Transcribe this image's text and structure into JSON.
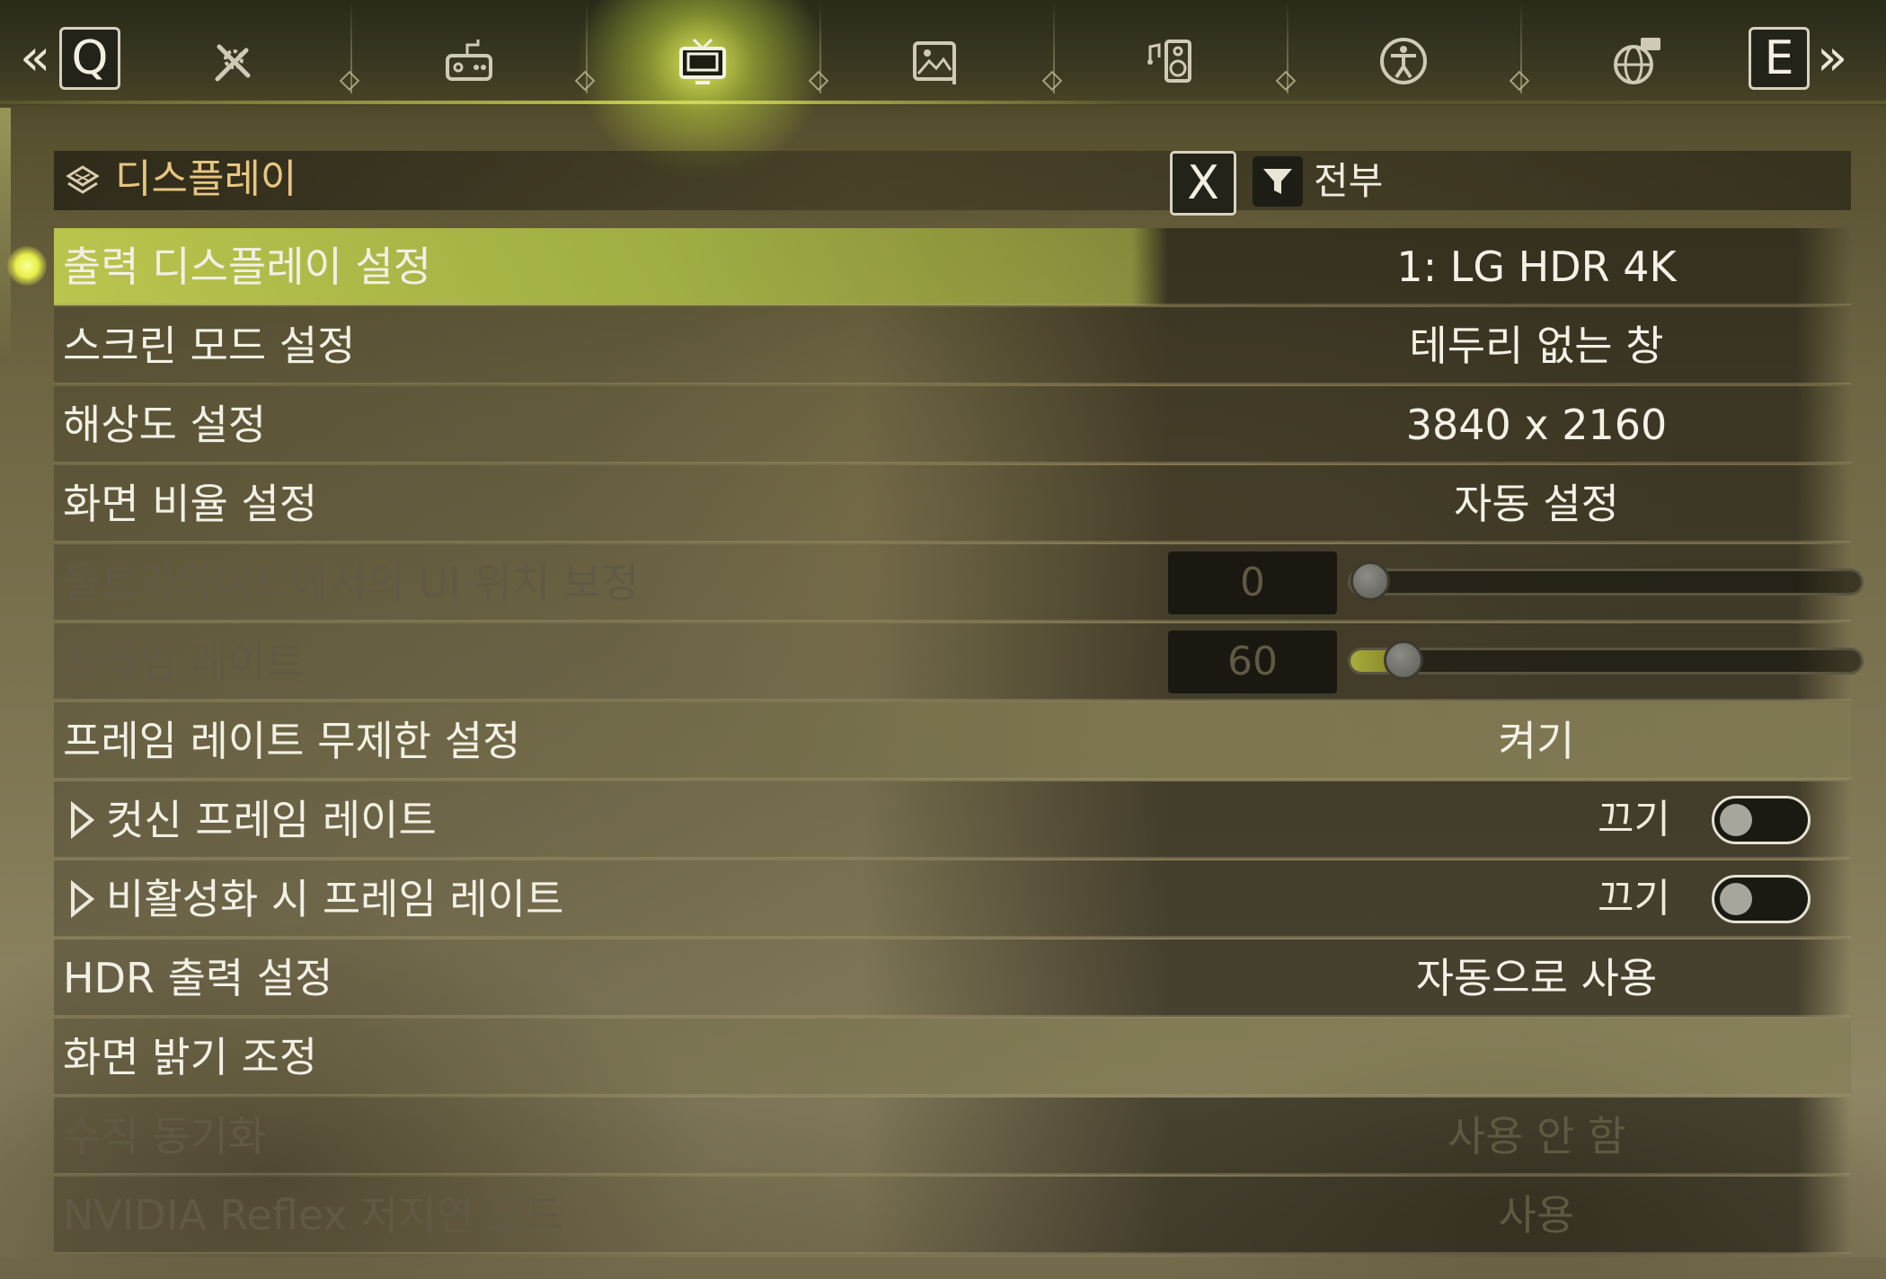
{
  "topbar": {
    "left_chevron": "«",
    "left_key": "Q",
    "right_key": "E",
    "right_chevron": "»",
    "tabs": [
      {
        "icon": "tools-icon",
        "active": false
      },
      {
        "icon": "gamepad-icon",
        "active": false
      },
      {
        "icon": "display-tv-icon",
        "active": true
      },
      {
        "icon": "image-brush-icon",
        "active": false
      },
      {
        "icon": "speaker-music-icon",
        "active": false
      },
      {
        "icon": "accessibility-icon",
        "active": false
      },
      {
        "icon": "globe-network-icon",
        "active": false
      }
    ]
  },
  "header": {
    "title": "디스플레이",
    "reset_key": "X",
    "filter_label": "전부"
  },
  "colors": {
    "accent_selected": "#c8d750",
    "title_gold": "#e7c681",
    "dim_text": "#605a44"
  },
  "settings": [
    {
      "label": "출력 디스플레이 설정",
      "value": "1: LG HDR 4K",
      "type": "select",
      "state": "selected"
    },
    {
      "label": "스크린 모드 설정",
      "value": "테두리 없는 창",
      "type": "select",
      "state": "normal"
    },
    {
      "label": "해상도 설정",
      "value": "3840 x 2160",
      "type": "select",
      "state": "normal"
    },
    {
      "label": "화면 비율 설정",
      "value": "자동 설정",
      "type": "select",
      "state": "normal"
    },
    {
      "label": "울트라와이드에서의 UI 위치 보정",
      "value": "0",
      "type": "slider",
      "state": "disabled",
      "slider_fraction": 0.0
    },
    {
      "label": "프레임 레이트",
      "value": "60",
      "type": "slider",
      "state": "disabled",
      "slider_fraction": 0.07
    },
    {
      "label": "프레임 레이트 무제한 설정",
      "value": "켜기",
      "type": "select",
      "state": "hover"
    },
    {
      "label": "컷신 프레임 레이트",
      "value": "끄기",
      "type": "toggle",
      "state": "normal",
      "sub": true
    },
    {
      "label": "비활성화 시 프레임 레이트",
      "value": "끄기",
      "type": "toggle",
      "state": "normal",
      "sub": true
    },
    {
      "label": "HDR 출력 설정",
      "value": "자동으로 사용",
      "type": "select",
      "state": "normal"
    },
    {
      "label": "화면 밝기 조정",
      "value": "",
      "type": "action",
      "state": "normal"
    },
    {
      "label": "수직 동기화",
      "value": "사용 안 함",
      "type": "select",
      "state": "disabled"
    },
    {
      "label": "NVIDIA Reflex 저지연 모드",
      "value": "사용",
      "type": "select",
      "state": "disabled"
    }
  ]
}
